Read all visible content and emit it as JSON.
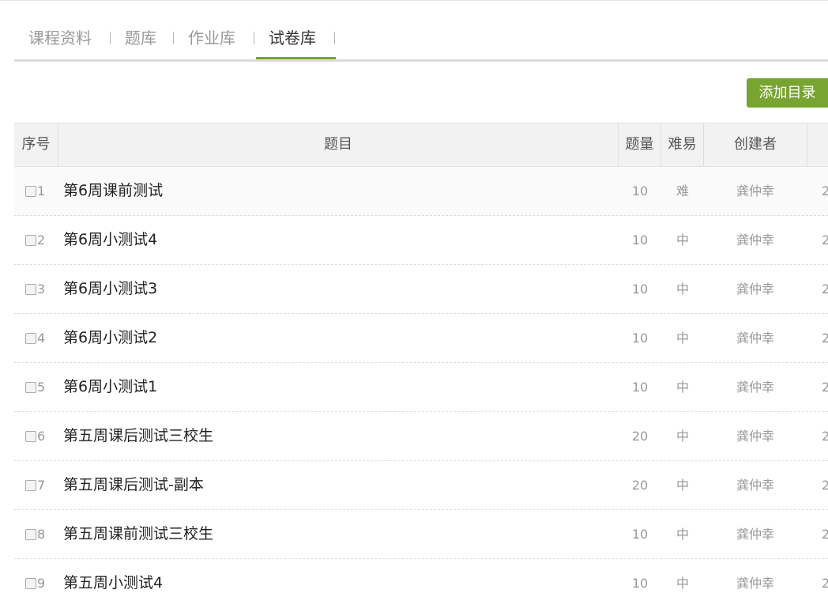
{
  "tabs": [
    {
      "label": "课程资料",
      "active": false
    },
    {
      "label": "题库",
      "active": false
    },
    {
      "label": "作业库",
      "active": false
    },
    {
      "label": "试卷库",
      "active": true
    }
  ],
  "toolbar": {
    "add_label": "添加目录"
  },
  "table": {
    "headers": {
      "index": "序号",
      "title": "题目",
      "quantity": "题量",
      "difficulty": "难易",
      "creator": "创建者"
    },
    "rows": [
      {
        "index": "1",
        "title": "第6周课前测试",
        "quantity": "10",
        "difficulty": "难",
        "creator": "龚仲幸",
        "extra": "2"
      },
      {
        "index": "2",
        "title": "第6周小测试4",
        "quantity": "10",
        "difficulty": "中",
        "creator": "龚仲幸",
        "extra": "2"
      },
      {
        "index": "3",
        "title": "第6周小测试3",
        "quantity": "10",
        "difficulty": "中",
        "creator": "龚仲幸",
        "extra": "2"
      },
      {
        "index": "4",
        "title": "第6周小测试2",
        "quantity": "10",
        "difficulty": "中",
        "creator": "龚仲幸",
        "extra": "2"
      },
      {
        "index": "5",
        "title": "第6周小测试1",
        "quantity": "10",
        "difficulty": "中",
        "creator": "龚仲幸",
        "extra": "2"
      },
      {
        "index": "6",
        "title": "第五周课后测试三校生",
        "quantity": "20",
        "difficulty": "中",
        "creator": "龚仲幸",
        "extra": "2"
      },
      {
        "index": "7",
        "title": "第五周课后测试-副本",
        "quantity": "20",
        "difficulty": "中",
        "creator": "龚仲幸",
        "extra": "2"
      },
      {
        "index": "8",
        "title": "第五周课前测试三校生",
        "quantity": "10",
        "difficulty": "中",
        "creator": "龚仲幸",
        "extra": "2"
      },
      {
        "index": "9",
        "title": "第五周小测试4",
        "quantity": "10",
        "difficulty": "中",
        "creator": "龚仲幸",
        "extra": "2"
      }
    ]
  }
}
